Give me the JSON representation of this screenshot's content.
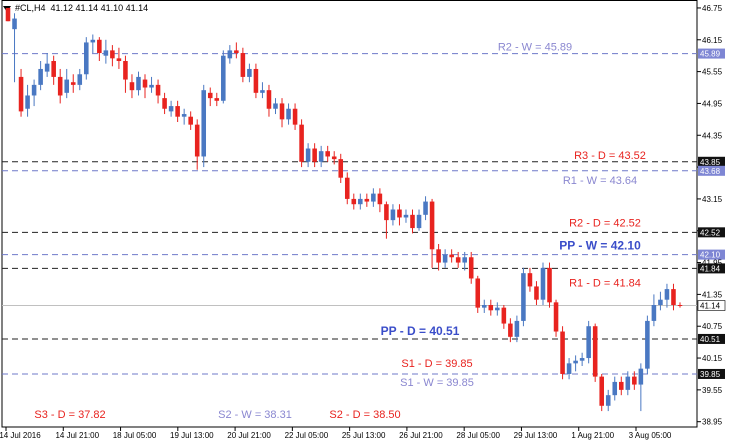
{
  "header": {
    "symbol": "#CL,H4",
    "ohlc": "41.12 41.14 41.10 41.14"
  },
  "colors": {
    "bull": "#4a78c2",
    "bear": "#e8231f",
    "weekly_line": "#6f79c9",
    "daily_line": "#222222",
    "weekly_text": "#8a87d0",
    "daily_text": "#e8231f",
    "pp_weekly_text": "#3a4dc9",
    "pp_daily_text": "#3a4dc9",
    "current_price_line": "#c0c0c0"
  },
  "chart_data": {
    "type": "candlestick",
    "symbol": "#CL",
    "timeframe": "H4",
    "ylim": [
      38.85,
      46.9
    ],
    "y_ticks": [
      38.95,
      39.55,
      40.15,
      40.75,
      41.35,
      41.95,
      42.55,
      43.15,
      43.75,
      44.35,
      44.95,
      45.55,
      46.15,
      46.75
    ],
    "x_tick_labels": [
      "14 Jul 2016",
      "14 Jul 21:00",
      "18 Jul 05:00",
      "19 Jul 13:00",
      "20 Jul 21:00",
      "22 Jul 05:00",
      "25 Jul 13:00",
      "26 Jul 21:00",
      "28 Jul 05:00",
      "29 Jul 13:00",
      "1 Aug 21:00",
      "3 Aug 05:00"
    ],
    "current_price": 41.14,
    "levels": [
      {
        "name": "R2 - W",
        "value": 45.89,
        "type": "weekly",
        "label": "R2 - W = 45.89",
        "tag": "45.89"
      },
      {
        "name": "R3 - D",
        "value": 43.85,
        "type": "daily",
        "label": "R3 - D = 43.52",
        "tag": "43.85"
      },
      {
        "name": "R1 - W",
        "value": 43.68,
        "type": "weekly",
        "label": "R1 - W = 43.64",
        "tag": "43.68"
      },
      {
        "name": "R2 - D",
        "value": 42.52,
        "type": "daily",
        "label": "R2 - D = 42.52",
        "tag": "42.52"
      },
      {
        "name": "PP - W",
        "value": 42.1,
        "type": "weekly_pp",
        "label": "PP - W = 42.10",
        "tag": "42.10"
      },
      {
        "name": "R1 - D",
        "value": 41.84,
        "type": "daily",
        "label": "R1 - D = 41.84",
        "tag": "41.84"
      },
      {
        "name": "PP - D",
        "value": 40.51,
        "type": "daily_pp",
        "label": "PP - D = 40.51",
        "tag": "40.51"
      },
      {
        "name": "S1 - D",
        "value": 39.85,
        "type": "daily",
        "label": "S1 - D = 39.85",
        "tag": "39.85"
      },
      {
        "name": "S1 - W",
        "value": 39.85,
        "type": "weekly",
        "label": "S1 - W = 39.85",
        "tag": ""
      }
    ],
    "bottom_labels": [
      {
        "text": "S3 - D = 37.82",
        "type": "daily"
      },
      {
        "text": "S2 - W = 38.31",
        "type": "weekly"
      },
      {
        "text": "S2 - D = 38.50",
        "type": "daily"
      }
    ],
    "candles": [
      [
        46.75,
        46.5,
        46.75,
        46.5
      ],
      [
        46.35,
        46.55,
        46.65,
        45.35
      ],
      [
        45.45,
        44.8,
        45.6,
        44.7
      ],
      [
        44.85,
        45.1,
        45.3,
        44.7
      ],
      [
        45.1,
        45.3,
        45.4,
        44.9
      ],
      [
        45.3,
        45.6,
        45.75,
        45.2
      ],
      [
        45.55,
        45.7,
        45.9,
        45.45
      ],
      [
        45.75,
        45.45,
        45.85,
        45.3
      ],
      [
        45.45,
        45.1,
        45.6,
        44.95
      ],
      [
        45.15,
        45.4,
        45.6,
        45.05
      ],
      [
        45.35,
        45.3,
        45.5,
        45.15
      ],
      [
        45.3,
        45.5,
        45.6,
        45.2
      ],
      [
        45.5,
        46.1,
        46.2,
        45.4
      ],
      [
        46.1,
        46.15,
        46.25,
        45.9
      ],
      [
        46.15,
        45.9,
        46.2,
        45.75
      ],
      [
        45.85,
        45.95,
        46.15,
        45.7
      ],
      [
        45.95,
        45.8,
        46.05,
        45.65
      ],
      [
        45.8,
        45.75,
        46.0,
        45.6
      ],
      [
        45.75,
        45.4,
        45.85,
        45.15
      ],
      [
        45.35,
        45.2,
        45.5,
        45.05
      ],
      [
        45.2,
        45.45,
        45.55,
        45.1
      ],
      [
        45.4,
        45.25,
        45.5,
        45.05
      ],
      [
        45.25,
        45.3,
        45.45,
        45.15
      ],
      [
        45.3,
        45.1,
        45.4,
        44.95
      ],
      [
        45.05,
        44.85,
        45.15,
        44.75
      ],
      [
        44.8,
        44.9,
        45.0,
        44.7
      ],
      [
        44.9,
        44.7,
        45.0,
        44.6
      ],
      [
        44.7,
        44.75,
        44.85,
        44.55
      ],
      [
        44.7,
        44.55,
        44.8,
        44.45
      ],
      [
        44.55,
        43.95,
        44.65,
        43.7
      ],
      [
        43.95,
        45.2,
        45.3,
        43.75
      ],
      [
        45.15,
        45.05,
        45.25,
        44.9
      ],
      [
        45.05,
        45.0,
        45.15,
        44.9
      ],
      [
        45.0,
        45.85,
        45.95,
        44.95
      ],
      [
        45.8,
        45.95,
        46.05,
        45.7
      ],
      [
        45.95,
        45.9,
        46.1,
        45.8
      ],
      [
        45.9,
        45.45,
        46.0,
        45.35
      ],
      [
        45.45,
        45.6,
        45.7,
        45.35
      ],
      [
        45.6,
        45.15,
        45.7,
        45.05
      ],
      [
        45.15,
        45.2,
        45.35,
        45.05
      ],
      [
        45.2,
        44.85,
        45.3,
        44.7
      ],
      [
        44.85,
        44.95,
        45.05,
        44.75
      ],
      [
        44.95,
        44.65,
        45.05,
        44.5
      ],
      [
        44.65,
        44.85,
        44.95,
        44.55
      ],
      [
        44.85,
        44.55,
        44.95,
        44.45
      ],
      [
        44.55,
        43.85,
        44.65,
        43.75
      ],
      [
        43.85,
        44.1,
        44.2,
        43.75
      ],
      [
        44.1,
        43.85,
        44.2,
        43.75
      ],
      [
        43.85,
        44.05,
        44.15,
        43.75
      ],
      [
        44.05,
        43.95,
        44.15,
        43.85
      ],
      [
        43.95,
        43.9,
        44.05,
        43.8
      ],
      [
        43.9,
        43.55,
        44.0,
        43.45
      ],
      [
        43.55,
        43.15,
        43.65,
        43.05
      ],
      [
        43.15,
        43.05,
        43.25,
        42.95
      ],
      [
        43.05,
        43.15,
        43.25,
        42.95
      ],
      [
        43.15,
        43.1,
        43.25,
        43.0
      ],
      [
        43.1,
        43.25,
        43.35,
        43.0
      ],
      [
        43.25,
        43.05,
        43.35,
        42.9
      ],
      [
        43.05,
        42.75,
        43.1,
        42.4
      ],
      [
        42.75,
        42.95,
        43.05,
        42.65
      ],
      [
        42.95,
        42.8,
        43.05,
        42.65
      ],
      [
        42.8,
        42.85,
        42.95,
        42.7
      ],
      [
        42.85,
        42.6,
        42.95,
        42.5
      ],
      [
        42.6,
        42.85,
        42.95,
        42.55
      ],
      [
        42.85,
        43.1,
        43.2,
        42.75
      ],
      [
        43.1,
        42.2,
        43.15,
        41.85
      ],
      [
        42.2,
        41.95,
        42.3,
        41.8
      ],
      [
        41.95,
        42.1,
        42.2,
        41.85
      ],
      [
        42.1,
        42.05,
        42.2,
        41.95
      ],
      [
        42.05,
        41.95,
        42.15,
        41.85
      ],
      [
        41.95,
        42.05,
        42.15,
        41.8
      ],
      [
        42.05,
        41.65,
        42.15,
        41.55
      ],
      [
        41.65,
        41.1,
        41.7,
        41.0
      ],
      [
        41.1,
        41.15,
        41.25,
        41.0
      ],
      [
        41.15,
        41.05,
        41.25,
        40.95
      ],
      [
        41.05,
        41.1,
        41.2,
        40.95
      ],
      [
        41.1,
        40.8,
        41.15,
        40.7
      ],
      [
        40.8,
        40.55,
        40.9,
        40.45
      ],
      [
        40.55,
        40.85,
        40.95,
        40.45
      ],
      [
        40.85,
        41.75,
        41.85,
        40.75
      ],
      [
        41.75,
        41.5,
        41.85,
        41.4
      ],
      [
        41.5,
        41.25,
        41.6,
        41.15
      ],
      [
        41.25,
        41.85,
        41.95,
        41.15
      ],
      [
        41.85,
        41.2,
        41.95,
        41.1
      ],
      [
        41.2,
        40.65,
        41.25,
        40.55
      ],
      [
        40.65,
        39.85,
        40.75,
        39.75
      ],
      [
        39.85,
        40.05,
        40.15,
        39.75
      ],
      [
        40.05,
        40.1,
        40.2,
        39.9
      ],
      [
        40.1,
        40.15,
        40.25,
        40.0
      ],
      [
        40.15,
        40.75,
        40.85,
        40.05
      ],
      [
        40.75,
        39.8,
        40.8,
        39.7
      ],
      [
        39.8,
        39.25,
        39.85,
        39.15
      ],
      [
        39.25,
        39.45,
        39.55,
        39.15
      ],
      [
        39.45,
        39.7,
        39.8,
        39.35
      ],
      [
        39.7,
        39.55,
        39.8,
        39.45
      ],
      [
        39.55,
        39.8,
        39.9,
        39.45
      ],
      [
        39.8,
        39.65,
        39.9,
        39.55
      ],
      [
        39.65,
        39.95,
        40.05,
        39.15
      ],
      [
        39.95,
        40.85,
        40.95,
        39.85
      ],
      [
        40.85,
        41.15,
        41.35,
        40.75
      ],
      [
        41.15,
        41.25,
        41.4,
        41.05
      ],
      [
        41.25,
        41.45,
        41.55,
        41.1
      ],
      [
        41.45,
        41.15,
        41.55,
        41.05
      ],
      [
        41.15,
        41.14,
        41.2,
        41.1
      ]
    ]
  }
}
